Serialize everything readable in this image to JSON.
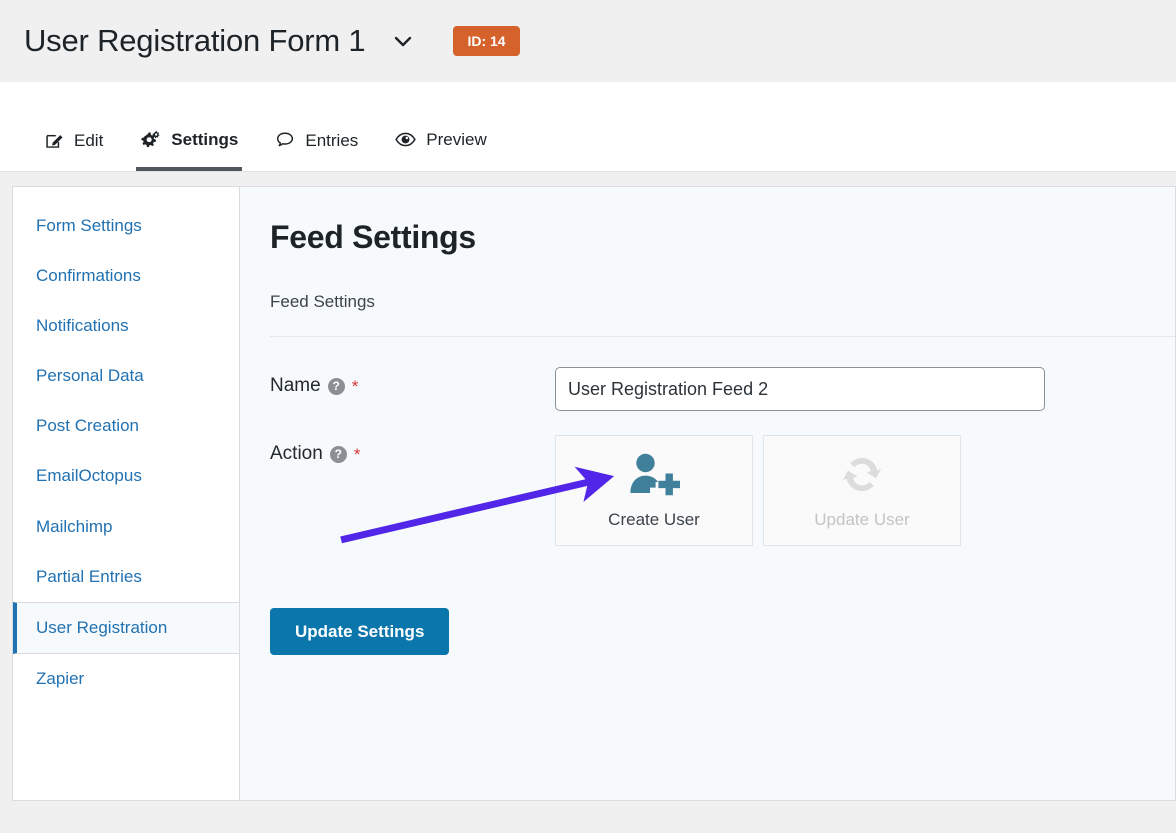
{
  "header": {
    "form_title": "User Registration Form 1",
    "chevron_icon": "chevron-down-icon",
    "id_badge": "ID: 14",
    "badge_color": "#d4622a"
  },
  "tabs": [
    {
      "label": "Edit",
      "icon": "pencil-square-icon",
      "active": false
    },
    {
      "label": "Settings",
      "icon": "gears-icon",
      "active": true
    },
    {
      "label": "Entries",
      "icon": "speech-bubble-icon",
      "active": false
    },
    {
      "label": "Preview",
      "icon": "eye-icon",
      "active": false
    }
  ],
  "sidebar": {
    "items": [
      {
        "label": "Form Settings",
        "active": false
      },
      {
        "label": "Confirmations",
        "active": false
      },
      {
        "label": "Notifications",
        "active": false
      },
      {
        "label": "Personal Data",
        "active": false
      },
      {
        "label": "Post Creation",
        "active": false
      },
      {
        "label": "EmailOctopus",
        "active": false
      },
      {
        "label": "Mailchimp",
        "active": false
      },
      {
        "label": "Partial Entries",
        "active": false
      },
      {
        "label": "User Registration",
        "active": true
      },
      {
        "label": "Zapier",
        "active": false
      }
    ],
    "link_color": "#2271b1"
  },
  "main": {
    "page_title": "Feed Settings",
    "section_title": "Feed Settings",
    "fields": {
      "name": {
        "label": "Name",
        "help_icon": "question-mark-icon",
        "required_marker": "*",
        "value": "User Registration Feed 2",
        "placeholder": ""
      },
      "action": {
        "label": "Action",
        "help_icon": "question-mark-icon",
        "required_marker": "*",
        "options": [
          {
            "label": "Create User",
            "icon": "user-plus-icon",
            "state": "selected",
            "icon_color": "#41809a"
          },
          {
            "label": "Update User",
            "icon": "sync-refresh-icon",
            "state": "disabled",
            "icon_color": "#dcdcdd"
          }
        ]
      }
    },
    "submit_button": "Update Settings",
    "submit_color": "#0b76ab"
  },
  "annotation": {
    "type": "arrow",
    "color": "#5226e8",
    "points_to": "Create User"
  }
}
